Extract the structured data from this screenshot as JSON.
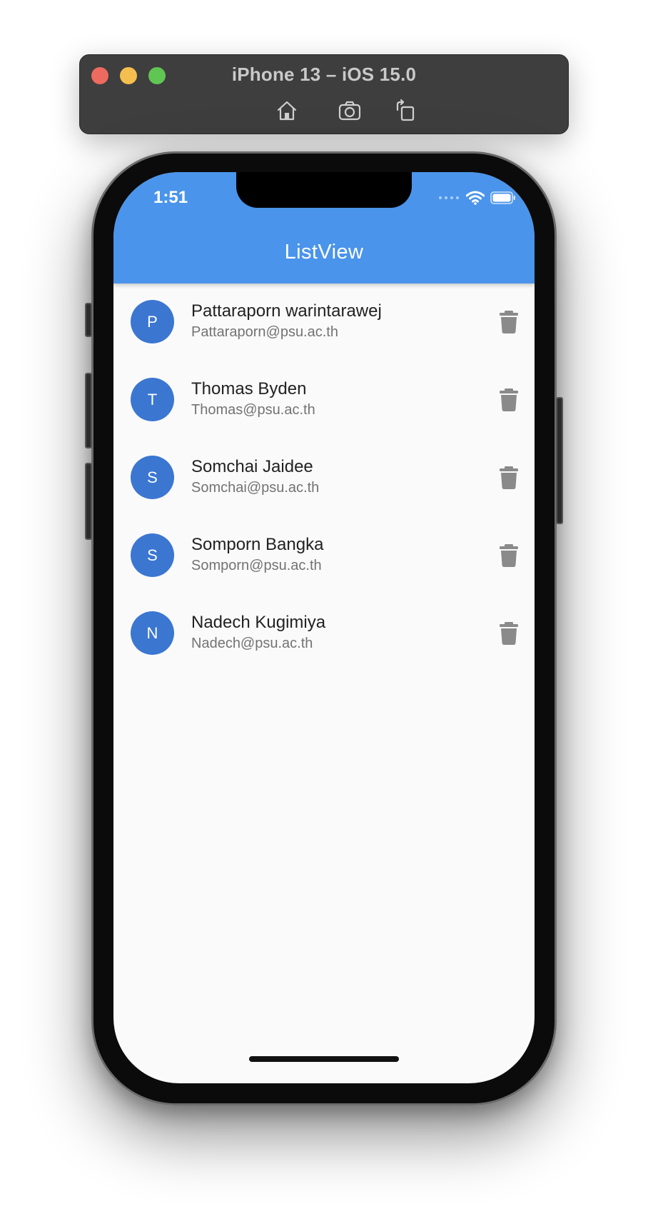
{
  "simulator": {
    "title": "iPhone 13 – iOS 15.0",
    "tools": [
      {
        "icon": "home-icon"
      },
      {
        "icon": "camera-icon"
      },
      {
        "icon": "rotate-icon"
      }
    ]
  },
  "status_bar": {
    "time": "1:51",
    "icons": [
      "signal-icon",
      "wifi-icon",
      "battery-icon"
    ]
  },
  "app_bar": {
    "title": "ListView",
    "color": "#4a94eb"
  },
  "list": {
    "items": [
      {
        "initial": "P",
        "name": "Pattaraporn warintarawej",
        "email": "Pattaraporn@psu.ac.th"
      },
      {
        "initial": "T",
        "name": "Thomas Byden",
        "email": "Thomas@psu.ac.th"
      },
      {
        "initial": "S",
        "name": "Somchai Jaidee",
        "email": "Somchai@psu.ac.th"
      },
      {
        "initial": "S",
        "name": "Somporn Bangka",
        "email": "Somporn@psu.ac.th"
      },
      {
        "initial": "N",
        "name": "Nadech Kugimiya",
        "email": "Nadech@psu.ac.th"
      }
    ],
    "avatar_color": "#3b76d1",
    "delete_icon": "trash-icon"
  }
}
